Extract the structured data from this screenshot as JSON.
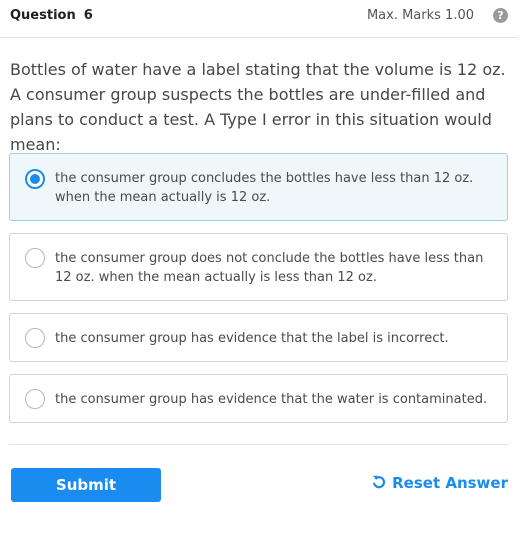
{
  "header": {
    "question_label": "Question",
    "question_number": "6",
    "max_marks": "Max. Marks 1.00",
    "help_icon": "help-circle-icon"
  },
  "question": {
    "text": "Bottles of water have a label stating that the volume is 12 oz. A consumer group suspects the bottles are under-filled and plans to conduct a test. A Type I error in this situation would mean:"
  },
  "options": [
    {
      "text": "the consumer group concludes the bottles have less than 12 oz. when the mean actually is 12 oz.",
      "selected": true
    },
    {
      "text": "the consumer group does not conclude the bottles have less than 12 oz. when the mean actually is less than 12 oz.",
      "selected": false
    },
    {
      "text": "the consumer group has evidence that the label is incorrect.",
      "selected": false
    },
    {
      "text": "the consumer group has evidence that the water is contaminated.",
      "selected": false
    }
  ],
  "actions": {
    "submit_label": "Submit",
    "reset_label": "Reset Answer",
    "reset_icon": "undo-icon"
  },
  "colors": {
    "accent": "#1a8cf0",
    "selected_bg": "#eef7f9",
    "selected_border": "#9fd0de"
  }
}
